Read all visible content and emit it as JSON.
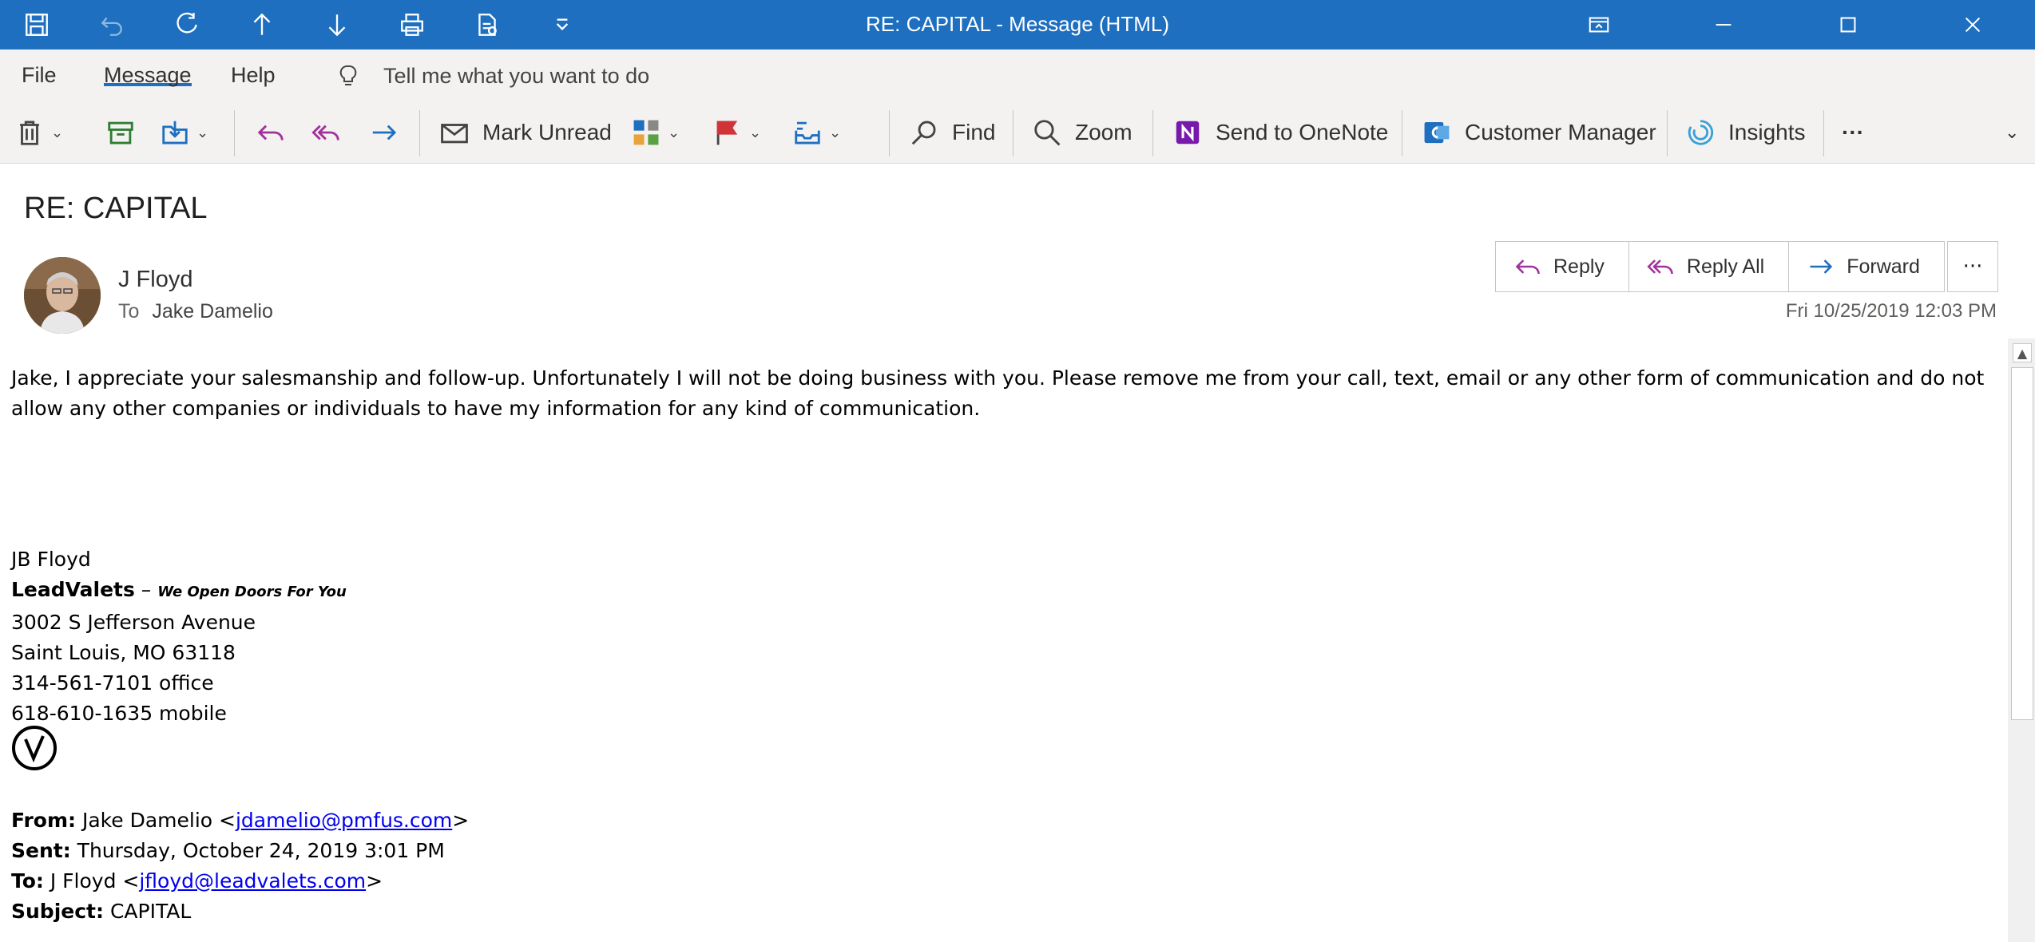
{
  "window": {
    "title": "RE: CAPITAL  -  Message (HTML)",
    "quick_access": [
      "save-icon",
      "undo-icon",
      "redo-icon",
      "previous-item-icon",
      "next-item-icon",
      "print-icon",
      "print-preview-icon",
      "customize-toolbar-icon"
    ]
  },
  "menu": {
    "items": [
      "File",
      "Message",
      "Help"
    ],
    "tell_me": "Tell me what you want to do"
  },
  "ribbon": {
    "mark_unread": "Mark Unread",
    "find": "Find",
    "zoom": "Zoom",
    "send_onenote": "Send to OneNote",
    "customer_manager": "Customer Manager",
    "insights": "Insights",
    "more": "···"
  },
  "message": {
    "subject": "RE: CAPITAL",
    "sender": "J Floyd",
    "to_label": "To",
    "to": "Jake Damelio",
    "date": "Fri 10/25/2019 12:03 PM",
    "actions": {
      "reply": "Reply",
      "reply_all": "Reply All",
      "forward": "Forward",
      "more": "···"
    },
    "body": "Jake, I appreciate your salesmanship and follow-up. Unfortunately I will not be doing business with you. Please remove me from your call, text, email or any other form of communication and do not allow any other companies or individuals to have my information for any kind of communication.",
    "signature": {
      "name": "JB Floyd",
      "company": "LeadValets",
      "dash": " – ",
      "tagline": "We Open Doors For You",
      "street": "3002 S Jefferson Avenue",
      "city": "Saint Louis, MO 63118",
      "office": "314-561-7101 office",
      "mobile": "618-610-1635 mobile"
    },
    "forwarded": {
      "from_label": "From:",
      "from_name": "Jake Damelio <",
      "from_email": "jdamelio@pmfus.com",
      "close": ">",
      "sent_label": "Sent:",
      "sent": "Thursday, October 24, 2019 3:01 PM",
      "to_label": "To:",
      "to_name": "J Floyd <",
      "to_email": "jfloyd@leadvalets.com",
      "subject_label": "Subject:",
      "subject": "CAPITAL"
    }
  },
  "colors": {
    "titlebar": "#1e6fbf",
    "reply_accent": "#a0339a",
    "forward_accent": "#1e6fbf"
  }
}
